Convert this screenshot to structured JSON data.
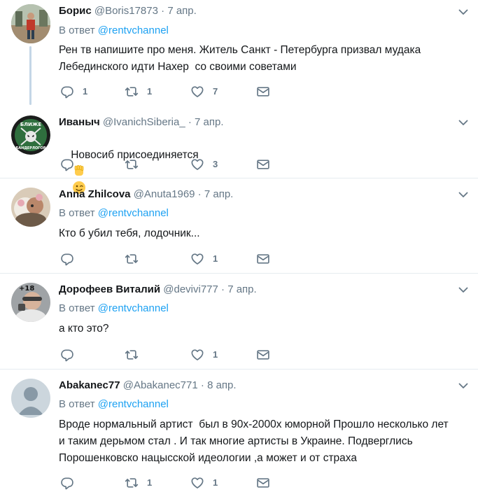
{
  "colors": {
    "link": "#1da1f2",
    "secondary": "#657786",
    "divider": "#e6ecf0",
    "thread_line": "#c4d6e6"
  },
  "tweets": [
    {
      "name": "Борис",
      "handle": "@Boris17873",
      "dot": "·",
      "time": "7 апр.",
      "reply_prefix": "В ответ ",
      "reply_handle": "@rentvchannel",
      "text": "Рен тв напишите про меня. Житель Санкт - Петербурга призвал мудака\nЛебединского идти Нахер  со своими советами",
      "replies": "1",
      "retweets": "1",
      "likes": "7"
    },
    {
      "name": "Иваныч",
      "handle": "@IvanichSiberia_",
      "dot": "·",
      "time": "7 апр.",
      "text": "Новосиб присоединяется",
      "emoji": [
        "raised-fist-icon",
        "winking-face-icon"
      ],
      "replies": "",
      "retweets": "",
      "likes": "3",
      "avatar_text": [
        "БЛИЖЕ",
        "БАНДЕРЛОГОВ"
      ]
    },
    {
      "name": "Anna Zhilcova",
      "handle": "@Anuta1969",
      "dot": "·",
      "time": "7 апр.",
      "reply_prefix": "В ответ ",
      "reply_handle": "@rentvchannel",
      "text": "Кто б убил тебя, лодочник...",
      "replies": "",
      "retweets": "",
      "likes": "1"
    },
    {
      "name": "Дорофеев Виталий",
      "handle": "@devivi777",
      "dot": "·",
      "time": "7 апр.",
      "reply_prefix": "В ответ ",
      "reply_handle": "@rentvchannel",
      "text": "а кто это?",
      "replies": "",
      "retweets": "",
      "likes": "1",
      "avatar_badge": "+18"
    },
    {
      "name": "Abakanec77",
      "handle": "@Abakanec771",
      "dot": "·",
      "time": "8 апр.",
      "reply_prefix": "В ответ ",
      "reply_handle": "@rentvchannel",
      "text": "Вроде нормальный артист  был в 90х-2000х юморной Прошло несколько лет\nи таким дерьмом стал . И так многие артисты в Украине. Подверглись\nПорошенковско нацысской идеологии ,а может и от страха",
      "replies": "",
      "retweets": "1",
      "likes": "1"
    }
  ]
}
